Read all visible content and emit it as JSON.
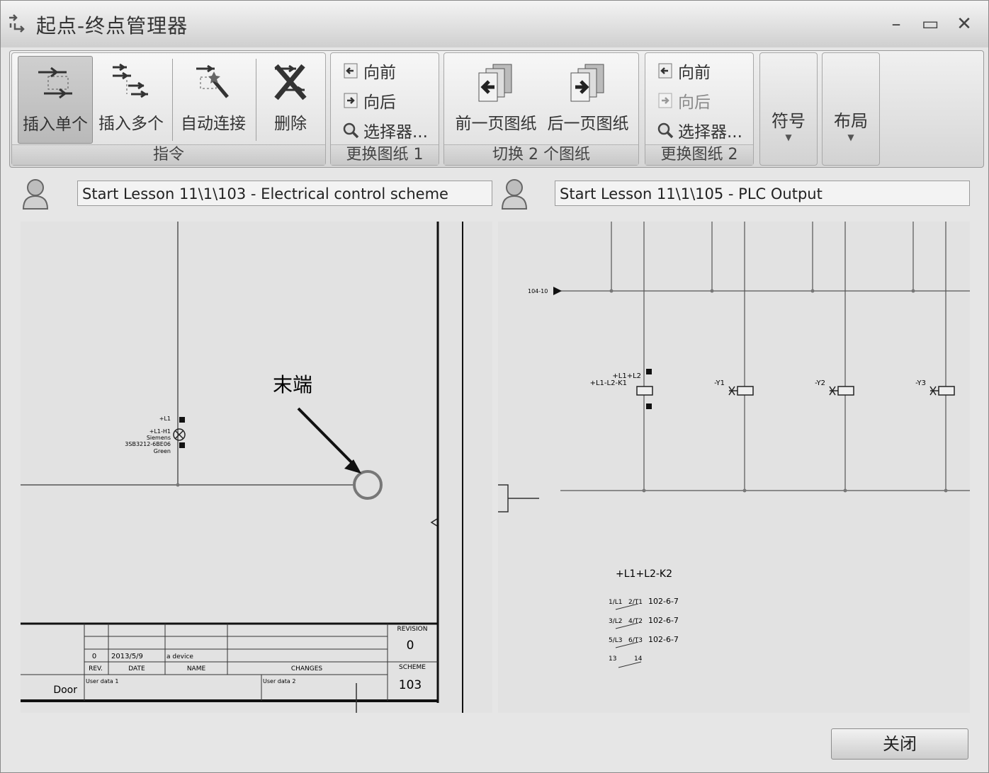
{
  "window": {
    "title": "起点-终点管理器"
  },
  "ribbon": {
    "commands_group": {
      "label": "指令",
      "insert_single": "插入单个",
      "insert_multiple": "插入多个",
      "auto_connect": "自动连接",
      "delete": "删除"
    },
    "sheet1_group": {
      "label": "更换图纸 1",
      "forward": "向前",
      "backward": "向后",
      "selector": "选择器..."
    },
    "switch_group": {
      "label": "切换 2 个图纸",
      "prev_page": "前一页图纸",
      "next_page": "后一页图纸"
    },
    "sheet2_group": {
      "label": "更换图纸 2",
      "forward": "向前",
      "backward": "向后",
      "selector": "选择器..."
    },
    "symbol": "符号",
    "layout": "布局"
  },
  "left_sheet": {
    "name": "Start Lesson 11\\1\\103 - Electrical control scheme",
    "annotation": "末端",
    "component_labels": [
      "+L1",
      "+L1-H1",
      "Siemens",
      "3SB3212-6BE06",
      "Green"
    ],
    "titleblock": {
      "rev": "0",
      "date": "2013/5/9",
      "change": "a device",
      "rev_header": "REV.",
      "date_header": "DATE",
      "name_header": "NAME",
      "changes_header": "CHANGES",
      "user_data1": "User data 1",
      "user_data2": "User data 2",
      "door": "Door",
      "revision_label": "REVISION",
      "revision_value": "0",
      "scheme_label": "SCHEME",
      "scheme_value": "103"
    }
  },
  "right_sheet": {
    "name": "Start Lesson 11\\1\\105 - PLC Output",
    "signal_label": "104-10",
    "coil_labels": [
      "+L1+L2",
      "+L1-L2-K1",
      "-Y1",
      "-Y2",
      "-Y3"
    ],
    "contact_ref": "+L1+L2-K2",
    "contacts": [
      {
        "a": "1/L1",
        "b": "2/T1",
        "ref": "102-6-7"
      },
      {
        "a": "3/L2",
        "b": "4/T2",
        "ref": "102-6-7"
      },
      {
        "a": "5/L3",
        "b": "6/T3",
        "ref": "102-6-7"
      },
      {
        "a": "13",
        "b": "14",
        "ref": ""
      }
    ]
  },
  "footer": {
    "close": "关闭"
  }
}
